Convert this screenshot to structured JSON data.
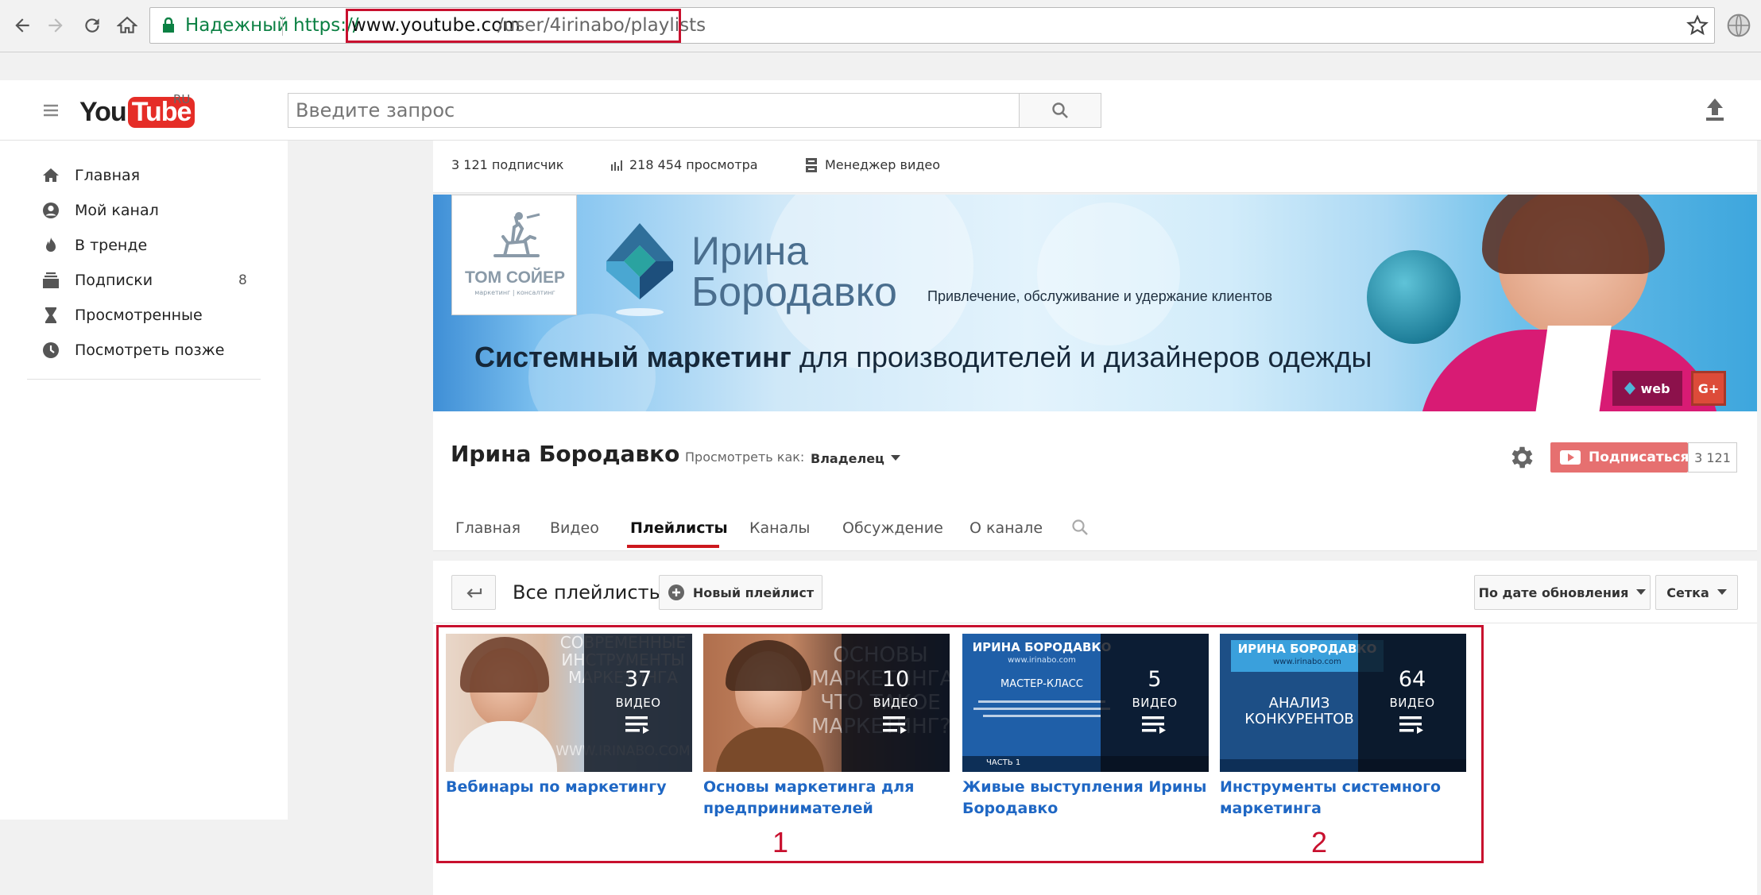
{
  "browser": {
    "secure_label": "Надежный",
    "url_scheme": "https://",
    "url_domain": "www.youtube.com",
    "url_path": "/user/4irinabo/playlists"
  },
  "header": {
    "logo_you": "You",
    "logo_tube": "Tube",
    "logo_region": "RU",
    "search_placeholder": "Введите запрос"
  },
  "sidebar": {
    "items": [
      {
        "label": "Главная",
        "icon": "home-icon"
      },
      {
        "label": "Мой канал",
        "icon": "account-icon"
      },
      {
        "label": "В тренде",
        "icon": "flame-icon"
      },
      {
        "label": "Подписки",
        "icon": "subscriptions-icon",
        "count": "8"
      },
      {
        "label": "Просмотренные",
        "icon": "hourglass-icon"
      },
      {
        "label": "Посмотреть позже",
        "icon": "clock-icon"
      }
    ]
  },
  "stats": {
    "subscribers": "3 121 подписчик",
    "views": "218 454 просмотра",
    "video_manager": "Менеджер видео"
  },
  "banner": {
    "logo_line1": "ТОМ СОЙЕР",
    "logo_line2": "маркетинг | консалтинг",
    "name_line1": "Ирина",
    "name_line2": "Бородавко",
    "tagline": "Привлечение, обслуживание и удержание клиентов",
    "headline_bold": "Системный маркетинг",
    "headline_rest": " для производителей и дизайнеров одежды",
    "link_web": "web",
    "link_gplus": "G+"
  },
  "channel": {
    "name": "Ирина Бородавко",
    "view_as_label": "Просмотреть как:",
    "view_as_value": "Владелец",
    "subscribe_label": "Подписаться",
    "subscribe_count": "3 121",
    "tabs": [
      "Главная",
      "Видео",
      "Плейлисты",
      "Каналы",
      "Обсуждение",
      "О канале"
    ],
    "active_tab": "Плейлисты"
  },
  "playlists": {
    "heading": "Все плейлисты",
    "new_playlist": "Новый плейлист",
    "sort_label": "По дате обновления",
    "view_label": "Сетка",
    "items": [
      {
        "title_l1": "Вебинары по маркетингу",
        "title_l2": "",
        "count": "37",
        "count_label": "ВИДЕО",
        "bg_text_l1": "СОВРЕМЕННЫЕ",
        "bg_text_l2": "ИНСТРУМЕНТЫ",
        "bg_text_l3": "МАРКЕТИНГА",
        "bg_text_l4": "WWW.IRINABO.COM"
      },
      {
        "title_l1": "Основы маркетинга для",
        "title_l2": "предпринимателей",
        "count": "10",
        "count_label": "ВИДЕО",
        "bg_text_l1": "ОСНОВЫ",
        "bg_text_l2": "МАРКЕТИНГА.",
        "bg_text_l3": "ЧТО ТАКОЕ",
        "bg_text_l4": "МАРКЕТИНГ?"
      },
      {
        "title_l1": "Живые выступления Ирины",
        "title_l2": "Бородавко",
        "count": "5",
        "count_label": "ВИДЕО",
        "bg_text_l1": "ИРИНА БОРОДАВКО",
        "bg_text_l2": "www.irinabo.com",
        "bg_text_l3": "МАСТЕР-КЛАСС",
        "bg_text_l4": "ЧАСТЬ 1"
      },
      {
        "title_l1": "Инструменты системного",
        "title_l2": "маркетинга",
        "count": "64",
        "count_label": "ВИДЕО",
        "bg_text_l1": "ИРИНА БОРОДАВКО",
        "bg_text_l2": "www.irinabo.com",
        "bg_text_l3": "АНАЛИЗ",
        "bg_text_l4": "КОНКУРЕНТОВ"
      }
    ]
  },
  "annotations": {
    "label_1": "1",
    "label_2": "2"
  },
  "colors": {
    "accent_red": "#c8102e",
    "link_blue": "#1f67c4",
    "secure_green": "#0b8043",
    "subscribe_red": "#e67070"
  }
}
